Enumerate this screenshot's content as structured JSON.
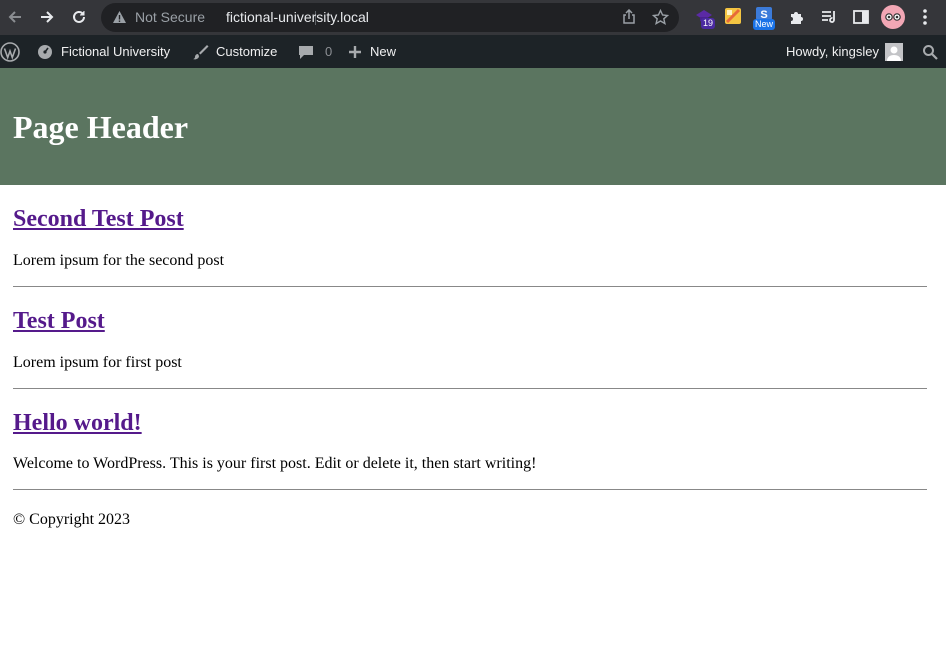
{
  "browser": {
    "security_label": "Not Secure",
    "url": "fictional-university.local",
    "extension_badges": {
      "ext1_count": "19",
      "ext3_label": "New"
    }
  },
  "adminbar": {
    "site_name": "Fictional University",
    "customize": "Customize",
    "comments_count": "0",
    "new_label": "New",
    "howdy": "Howdy, kingsley"
  },
  "header": {
    "title": "Page Header"
  },
  "posts": [
    {
      "title": "Second Test Post",
      "excerpt": "Lorem ipsum for the second post"
    },
    {
      "title": "Test Post",
      "excerpt": "Lorem ipsum for first post"
    },
    {
      "title": "Hello world!",
      "excerpt": "Welcome to WordPress. This is your first post. Edit or delete it, then start writing!"
    }
  ],
  "footer": {
    "copyright": "© Copyright 2023"
  },
  "colors": {
    "header_bg": "#5b7560",
    "link": "#551a8b",
    "adminbar_bg": "#1d2327",
    "chrome_bg": "#35363a"
  }
}
